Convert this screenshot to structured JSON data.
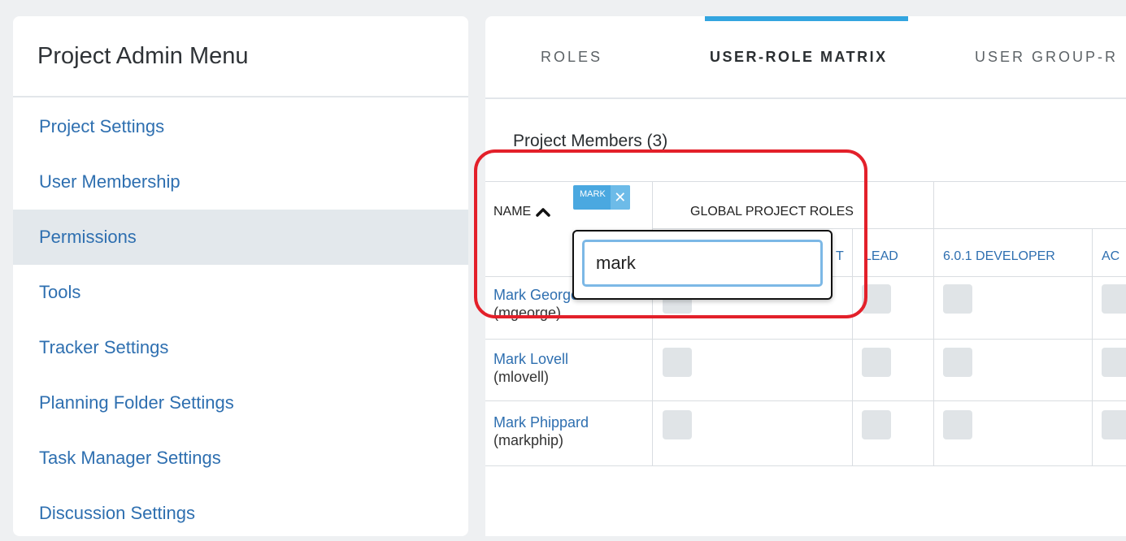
{
  "sidebar": {
    "title": "Project Admin Menu",
    "items": [
      {
        "label": "Project Settings"
      },
      {
        "label": "User Membership"
      },
      {
        "label": "Permissions"
      },
      {
        "label": "Tools"
      },
      {
        "label": "Tracker Settings"
      },
      {
        "label": "Planning Folder Settings"
      },
      {
        "label": "Task Manager Settings"
      },
      {
        "label": "Discussion Settings"
      }
    ],
    "active_item": "Permissions"
  },
  "tabs": [
    {
      "label": "ROLES"
    },
    {
      "label": "USER-ROLE MATRIX"
    },
    {
      "label": "USER GROUP-R"
    }
  ],
  "active_tab": "USER-ROLE MATRIX",
  "members": {
    "title": "Project Members (3)",
    "name_header": "NAME",
    "filter_chip": "MARK",
    "group_header": "GLOBAL PROJECT ROLES",
    "role_columns": [
      "T",
      "LEAD",
      "6.0.1 DEVELOPER",
      "AC"
    ],
    "rows": [
      {
        "name": "Mark George",
        "username": "(mgeorge)"
      },
      {
        "name": "Mark Lovell",
        "username": "(mlovell)"
      },
      {
        "name": "Mark Phippard",
        "username": "(markphip)"
      }
    ]
  },
  "filter_popover": {
    "value": "mark"
  },
  "colors": {
    "accent": "#33a5e0",
    "link": "#2e6fb0",
    "highlight": "#e3202a",
    "active_menu_bg": "#e3e8ec"
  }
}
